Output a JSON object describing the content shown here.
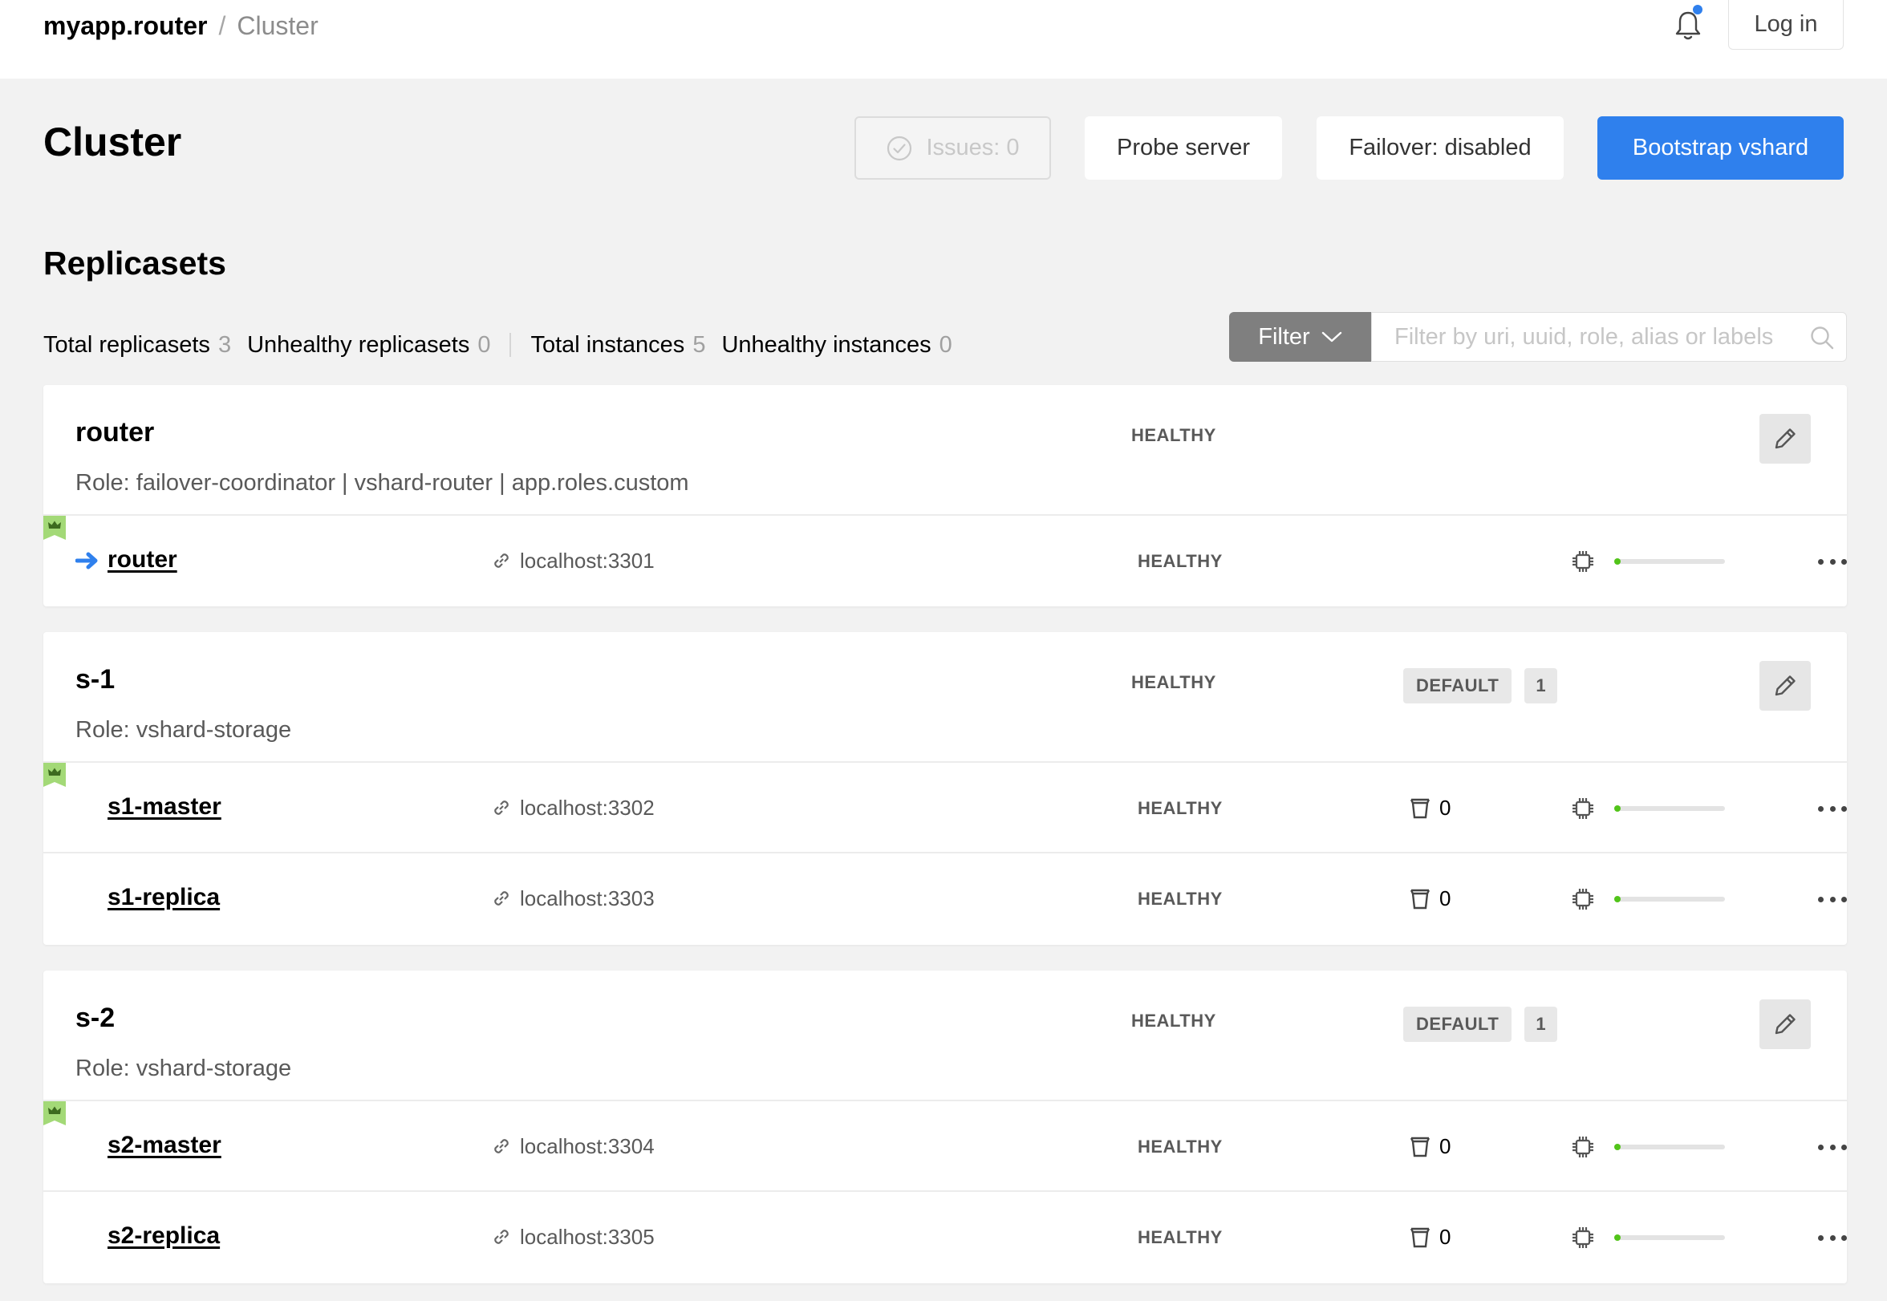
{
  "header": {
    "app_name": "myapp.router",
    "separator": "/",
    "page": "Cluster",
    "login_label": "Log in"
  },
  "page_title": "Cluster",
  "actions": {
    "issues_label": "Issues: 0",
    "probe_label": "Probe server",
    "failover_label": "Failover: disabled",
    "bootstrap_label": "Bootstrap vshard"
  },
  "section_title": "Replicasets",
  "stats": {
    "total_replicasets_label": "Total replicasets",
    "total_replicasets": "3",
    "unhealthy_replicasets_label": "Unhealthy replicasets",
    "unhealthy_replicasets": "0",
    "total_instances_label": "Total instances",
    "total_instances": "5",
    "unhealthy_instances_label": "Unhealthy instances",
    "unhealthy_instances": "0"
  },
  "filter": {
    "button_label": "Filter",
    "placeholder": "Filter by uri, uuid, role, alias or labels"
  },
  "replicasets": [
    {
      "name": "router",
      "role": "Role: failover-coordinator | vshard-router | app.roles.custom",
      "status": "HEALTHY",
      "instances": [
        {
          "name": "router",
          "uri": "localhost:3301",
          "status": "HEALTHY",
          "leader": true
        }
      ]
    },
    {
      "name": "s-1",
      "role": "Role: vshard-storage",
      "status": "HEALTHY",
      "vshard_group": "DEFAULT",
      "weight": "1",
      "instances": [
        {
          "name": "s1-master",
          "uri": "localhost:3302",
          "status": "HEALTHY",
          "buckets": "0",
          "leader": true
        },
        {
          "name": "s1-replica",
          "uri": "localhost:3303",
          "status": "HEALTHY",
          "buckets": "0",
          "leader": false
        }
      ]
    },
    {
      "name": "s-2",
      "role": "Role: vshard-storage",
      "status": "HEALTHY",
      "vshard_group": "DEFAULT",
      "weight": "1",
      "instances": [
        {
          "name": "s2-master",
          "uri": "localhost:3304",
          "status": "HEALTHY",
          "buckets": "0",
          "leader": true
        },
        {
          "name": "s2-replica",
          "uri": "localhost:3305",
          "status": "HEALTHY",
          "buckets": "0",
          "leader": false
        }
      ]
    }
  ],
  "colors": {
    "accent": "#2f80ed",
    "crown": "#a3d977",
    "memory_ok": "#52c41a"
  }
}
